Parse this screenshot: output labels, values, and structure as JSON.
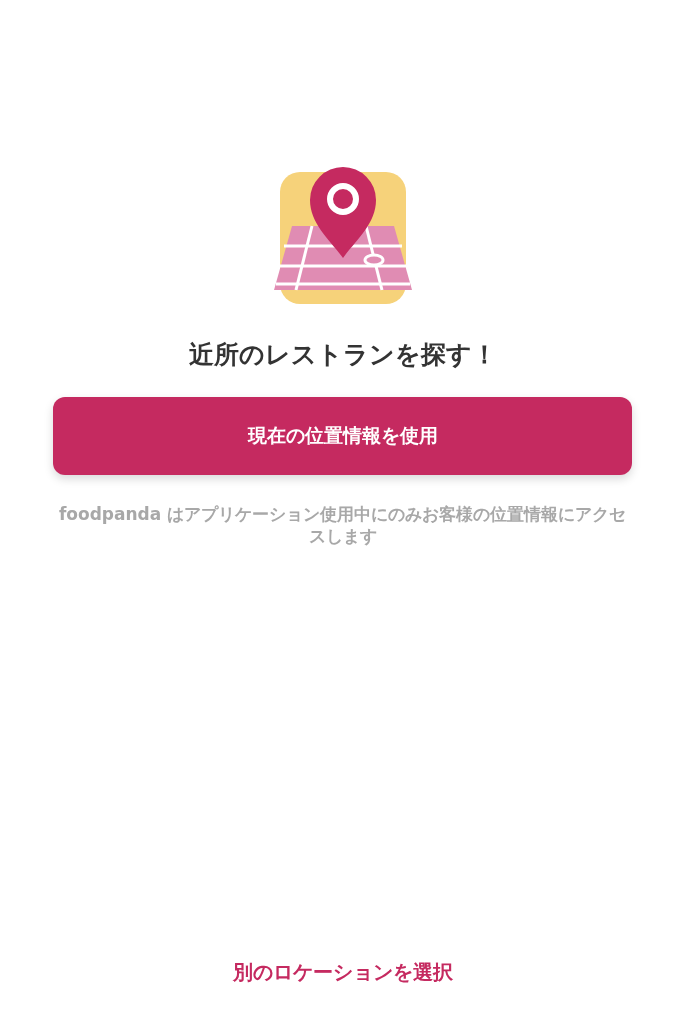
{
  "heading": "近所のレストランを探す！",
  "primary_button": {
    "label": "現在の位置情報を使用"
  },
  "notice": "foodpanda はアプリケーション使用中にのみお客様の位置情報にアクセスします",
  "secondary_link": {
    "label": "別のロケーションを選択"
  }
}
